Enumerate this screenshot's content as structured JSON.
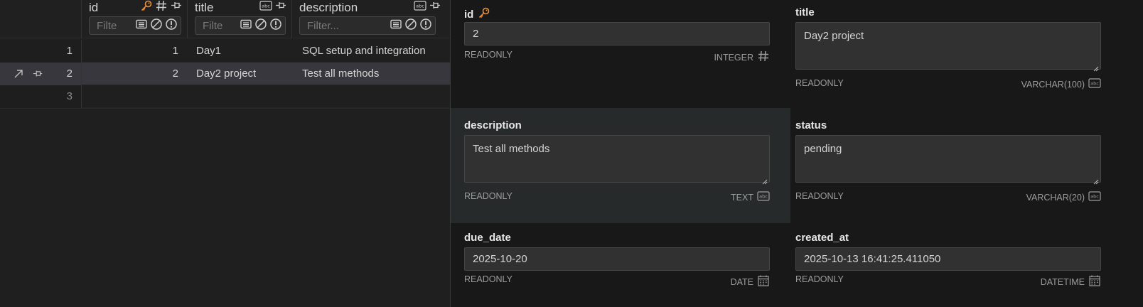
{
  "grid": {
    "columns": [
      {
        "name": "id",
        "filter_placeholder": "Filte"
      },
      {
        "name": "title",
        "filter_placeholder": "Filte"
      },
      {
        "name": "description",
        "filter_placeholder": "Filter..."
      }
    ],
    "rows": [
      {
        "rownum": "1",
        "id": "1",
        "title": "Day1",
        "description": "SQL setup and integration"
      },
      {
        "rownum": "2",
        "id": "2",
        "title": "Day2 project",
        "description": "Test all methods"
      },
      {
        "rownum": "3",
        "id": "",
        "title": "",
        "description": ""
      }
    ],
    "selected_row": 2
  },
  "form": {
    "fields": [
      {
        "label": "id",
        "value": "2",
        "access": "READONLY",
        "type": "INTEGER",
        "type_icon": "hash-icon"
      },
      {
        "label": "title",
        "value": "Day2 project",
        "access": "READONLY",
        "type": "VARCHAR(100)",
        "type_icon": "abc-icon"
      },
      {
        "label": "description",
        "value": "Test all methods",
        "access": "READONLY",
        "type": "TEXT",
        "type_icon": "abc-icon"
      },
      {
        "label": "status",
        "value": "pending",
        "access": "READONLY",
        "type": "VARCHAR(20)",
        "type_icon": "abc-icon"
      },
      {
        "label": "due_date",
        "value": "2025-10-20",
        "access": "READONLY",
        "type": "DATE",
        "type_icon": "calendar-icon"
      },
      {
        "label": "created_at",
        "value": "2025-10-13 16:41:25.411050",
        "access": "READONLY",
        "type": "DATETIME",
        "type_icon": "calendar-icon"
      }
    ]
  },
  "colors": {
    "key_icon": "#e8913a",
    "selected_row": "#37373d",
    "highlight_field": "#262a2b"
  }
}
